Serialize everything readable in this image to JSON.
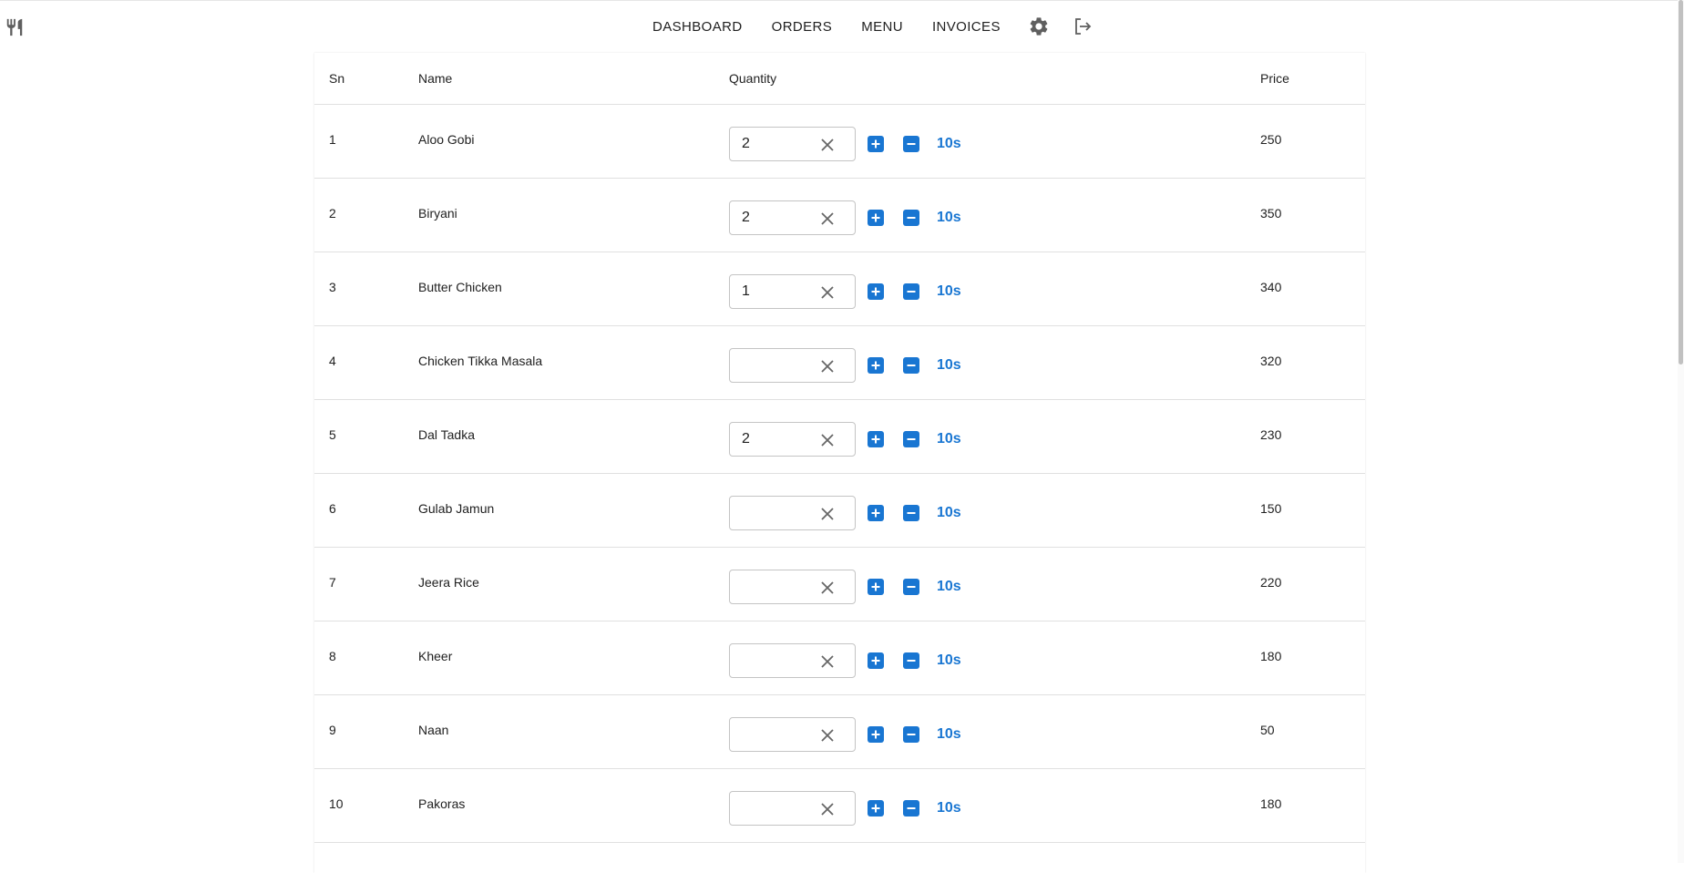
{
  "nav": {
    "items": [
      "DASHBOARD",
      "ORDERS",
      "MENU",
      "INVOICES"
    ],
    "logo_icon": "restaurant-icon",
    "settings_icon": "gear-icon",
    "logout_icon": "logout-icon"
  },
  "table": {
    "headers": {
      "sn": "Sn",
      "name": "Name",
      "quantity": "Quantity",
      "price": "Price"
    },
    "rows": [
      {
        "sn": "1",
        "name": "Aloo Gobi",
        "quantity": "2",
        "quick_add": "10s",
        "price": "250"
      },
      {
        "sn": "2",
        "name": "Biryani",
        "quantity": "2",
        "quick_add": "10s",
        "price": "350"
      },
      {
        "sn": "3",
        "name": "Butter Chicken",
        "quantity": "1",
        "quick_add": "10s",
        "price": "340"
      },
      {
        "sn": "4",
        "name": "Chicken Tikka Masala",
        "quantity": "",
        "quick_add": "10s",
        "price": "320"
      },
      {
        "sn": "5",
        "name": "Dal Tadka",
        "quantity": "2",
        "quick_add": "10s",
        "price": "230"
      },
      {
        "sn": "6",
        "name": "Gulab Jamun",
        "quantity": "",
        "quick_add": "10s",
        "price": "150"
      },
      {
        "sn": "7",
        "name": "Jeera Rice",
        "quantity": "",
        "quick_add": "10s",
        "price": "220"
      },
      {
        "sn": "8",
        "name": "Kheer",
        "quantity": "",
        "quick_add": "10s",
        "price": "180"
      },
      {
        "sn": "9",
        "name": "Naan",
        "quantity": "",
        "quick_add": "10s",
        "price": "50"
      },
      {
        "sn": "10",
        "name": "Pakoras",
        "quantity": "",
        "quick_add": "10s",
        "price": "180"
      }
    ]
  },
  "colors": {
    "accent": "#1976d2",
    "divider": "#e0e0e0",
    "text": "#212121",
    "icon": "#5f5f5f"
  }
}
